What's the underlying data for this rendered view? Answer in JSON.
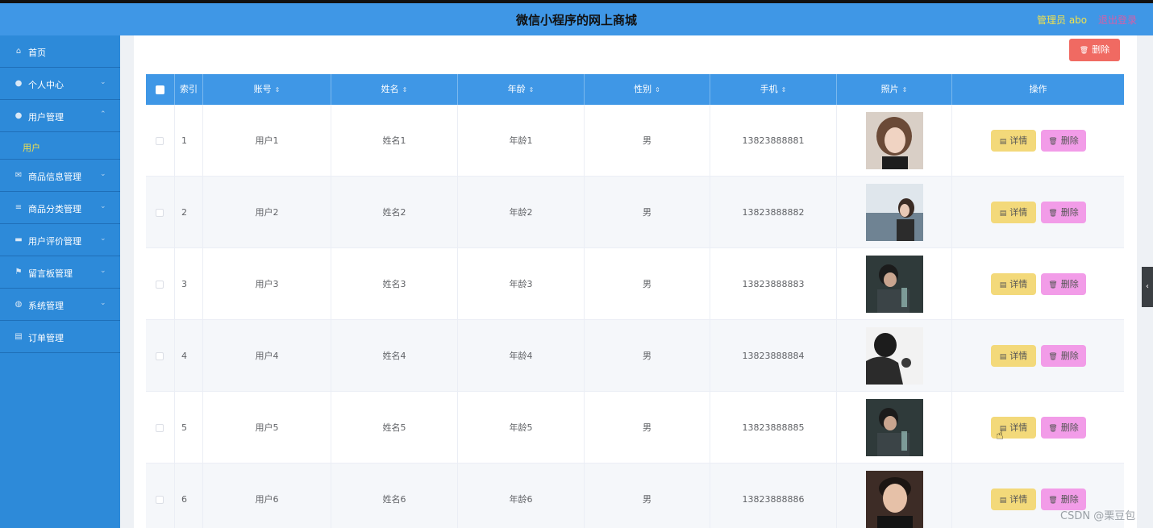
{
  "header": {
    "title": "微信小程序的网上商城",
    "admin": "管理员 abo",
    "logout": "退出登录"
  },
  "sidebar": {
    "items": [
      {
        "label": "首页",
        "icon": "home-icon",
        "glyph": "⌂",
        "arrow": ""
      },
      {
        "label": "个人中心",
        "icon": "user-icon",
        "glyph": "●",
        "arrow": "⌄"
      },
      {
        "label": "用户管理",
        "icon": "user-icon",
        "glyph": "●",
        "arrow": "⌃"
      },
      {
        "label": "商品信息管理",
        "icon": "mail-icon",
        "glyph": "✉",
        "arrow": "⌄"
      },
      {
        "label": "商品分类管理",
        "icon": "list-icon",
        "glyph": "≡",
        "arrow": "⌄"
      },
      {
        "label": "用户评价管理",
        "icon": "comment-icon",
        "glyph": "▬",
        "arrow": "⌄"
      },
      {
        "label": "留言板管理",
        "icon": "flag-icon",
        "glyph": "⚑",
        "arrow": "⌄"
      },
      {
        "label": "系统管理",
        "icon": "globe-icon",
        "glyph": "◍",
        "arrow": "⌄"
      },
      {
        "label": "订单管理",
        "icon": "clipboard-icon",
        "glyph": "▤",
        "arrow": ""
      }
    ],
    "submenu": {
      "label": "用户"
    }
  },
  "toolbar": {
    "delete_label": "删除"
  },
  "table": {
    "headers": [
      "索引",
      "账号",
      "姓名",
      "年龄",
      "性别",
      "手机",
      "照片",
      "操作"
    ],
    "detail_label": "详情",
    "delete_label": "删除",
    "rows": [
      {
        "index": "1",
        "account": "用户1",
        "name": "姓名1",
        "age": "年龄1",
        "gender": "男",
        "phone": "13823888881"
      },
      {
        "index": "2",
        "account": "用户2",
        "name": "姓名2",
        "age": "年龄2",
        "gender": "男",
        "phone": "13823888882"
      },
      {
        "index": "3",
        "account": "用户3",
        "name": "姓名3",
        "age": "年龄3",
        "gender": "男",
        "phone": "13823888883"
      },
      {
        "index": "4",
        "account": "用户4",
        "name": "姓名4",
        "age": "年龄4",
        "gender": "男",
        "phone": "13823888884"
      },
      {
        "index": "5",
        "account": "用户5",
        "name": "姓名5",
        "age": "年龄5",
        "gender": "男",
        "phone": "13823888885"
      },
      {
        "index": "6",
        "account": "用户6",
        "name": "姓名6",
        "age": "年龄6",
        "gender": "男",
        "phone": "13823888886"
      }
    ]
  },
  "watermark": "CSDN @栗豆包",
  "colors": {
    "header": "#3f97e6",
    "sidebar": "#2d8ad9",
    "detail": "#f3d97a",
    "delete": "#f29ce8",
    "danger": "#f06a62"
  }
}
